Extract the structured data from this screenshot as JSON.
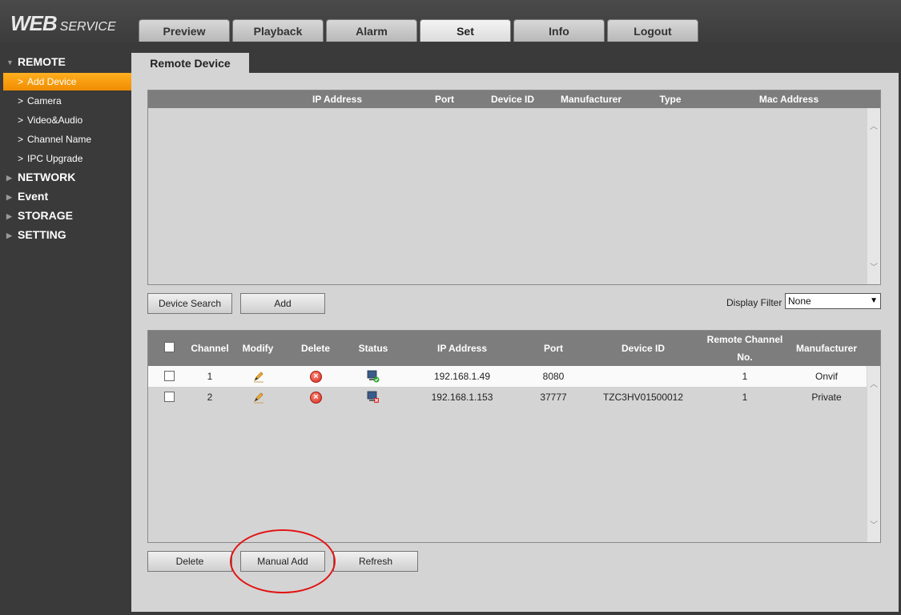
{
  "logo": {
    "web": "WEB",
    "service": "SERVICE"
  },
  "tabs": [
    "Preview",
    "Playback",
    "Alarm",
    "Set",
    "Info",
    "Logout"
  ],
  "active_tab": "Set",
  "sidebar": {
    "remote": "REMOTE",
    "items": [
      "Add Device",
      "Camera",
      "Video&Audio",
      "Channel Name",
      "IPC Upgrade"
    ],
    "network": "NETWORK",
    "event": "Event",
    "storage": "STORAGE",
    "setting": "SETTING"
  },
  "page_tab": "Remote Device",
  "search_table": {
    "headers": [
      "IP Address",
      "Port",
      "Device ID",
      "Manufacturer",
      "Type",
      "Mac Address"
    ]
  },
  "buttons": {
    "device_search": "Device Search",
    "add": "Add",
    "delete": "Delete",
    "manual_add": "Manual Add",
    "refresh": "Refresh"
  },
  "display_filter": {
    "label": "Display Filter",
    "value": "None"
  },
  "added_table": {
    "headers": {
      "channel": "Channel",
      "modify": "Modify",
      "delete": "Delete",
      "status": "Status",
      "ip": "IP Address",
      "port": "Port",
      "device_id": "Device ID",
      "remote_channel_1": "Remote Channel",
      "remote_channel_2": "No.",
      "manufacturer": "Manufacturer"
    },
    "rows": [
      {
        "channel": "1",
        "ip": "192.168.1.49",
        "port": "8080",
        "device_id": "",
        "remote_channel": "1",
        "manufacturer": "Onvif",
        "status": "online"
      },
      {
        "channel": "2",
        "ip": "192.168.1.153",
        "port": "37777",
        "device_id": "TZC3HV01500012",
        "remote_channel": "1",
        "manufacturer": "Private",
        "status": "offline"
      }
    ]
  },
  "colors": {
    "accent": "#f59a10",
    "header": "#7d7d7d",
    "highlight_circle": "#e21313"
  }
}
